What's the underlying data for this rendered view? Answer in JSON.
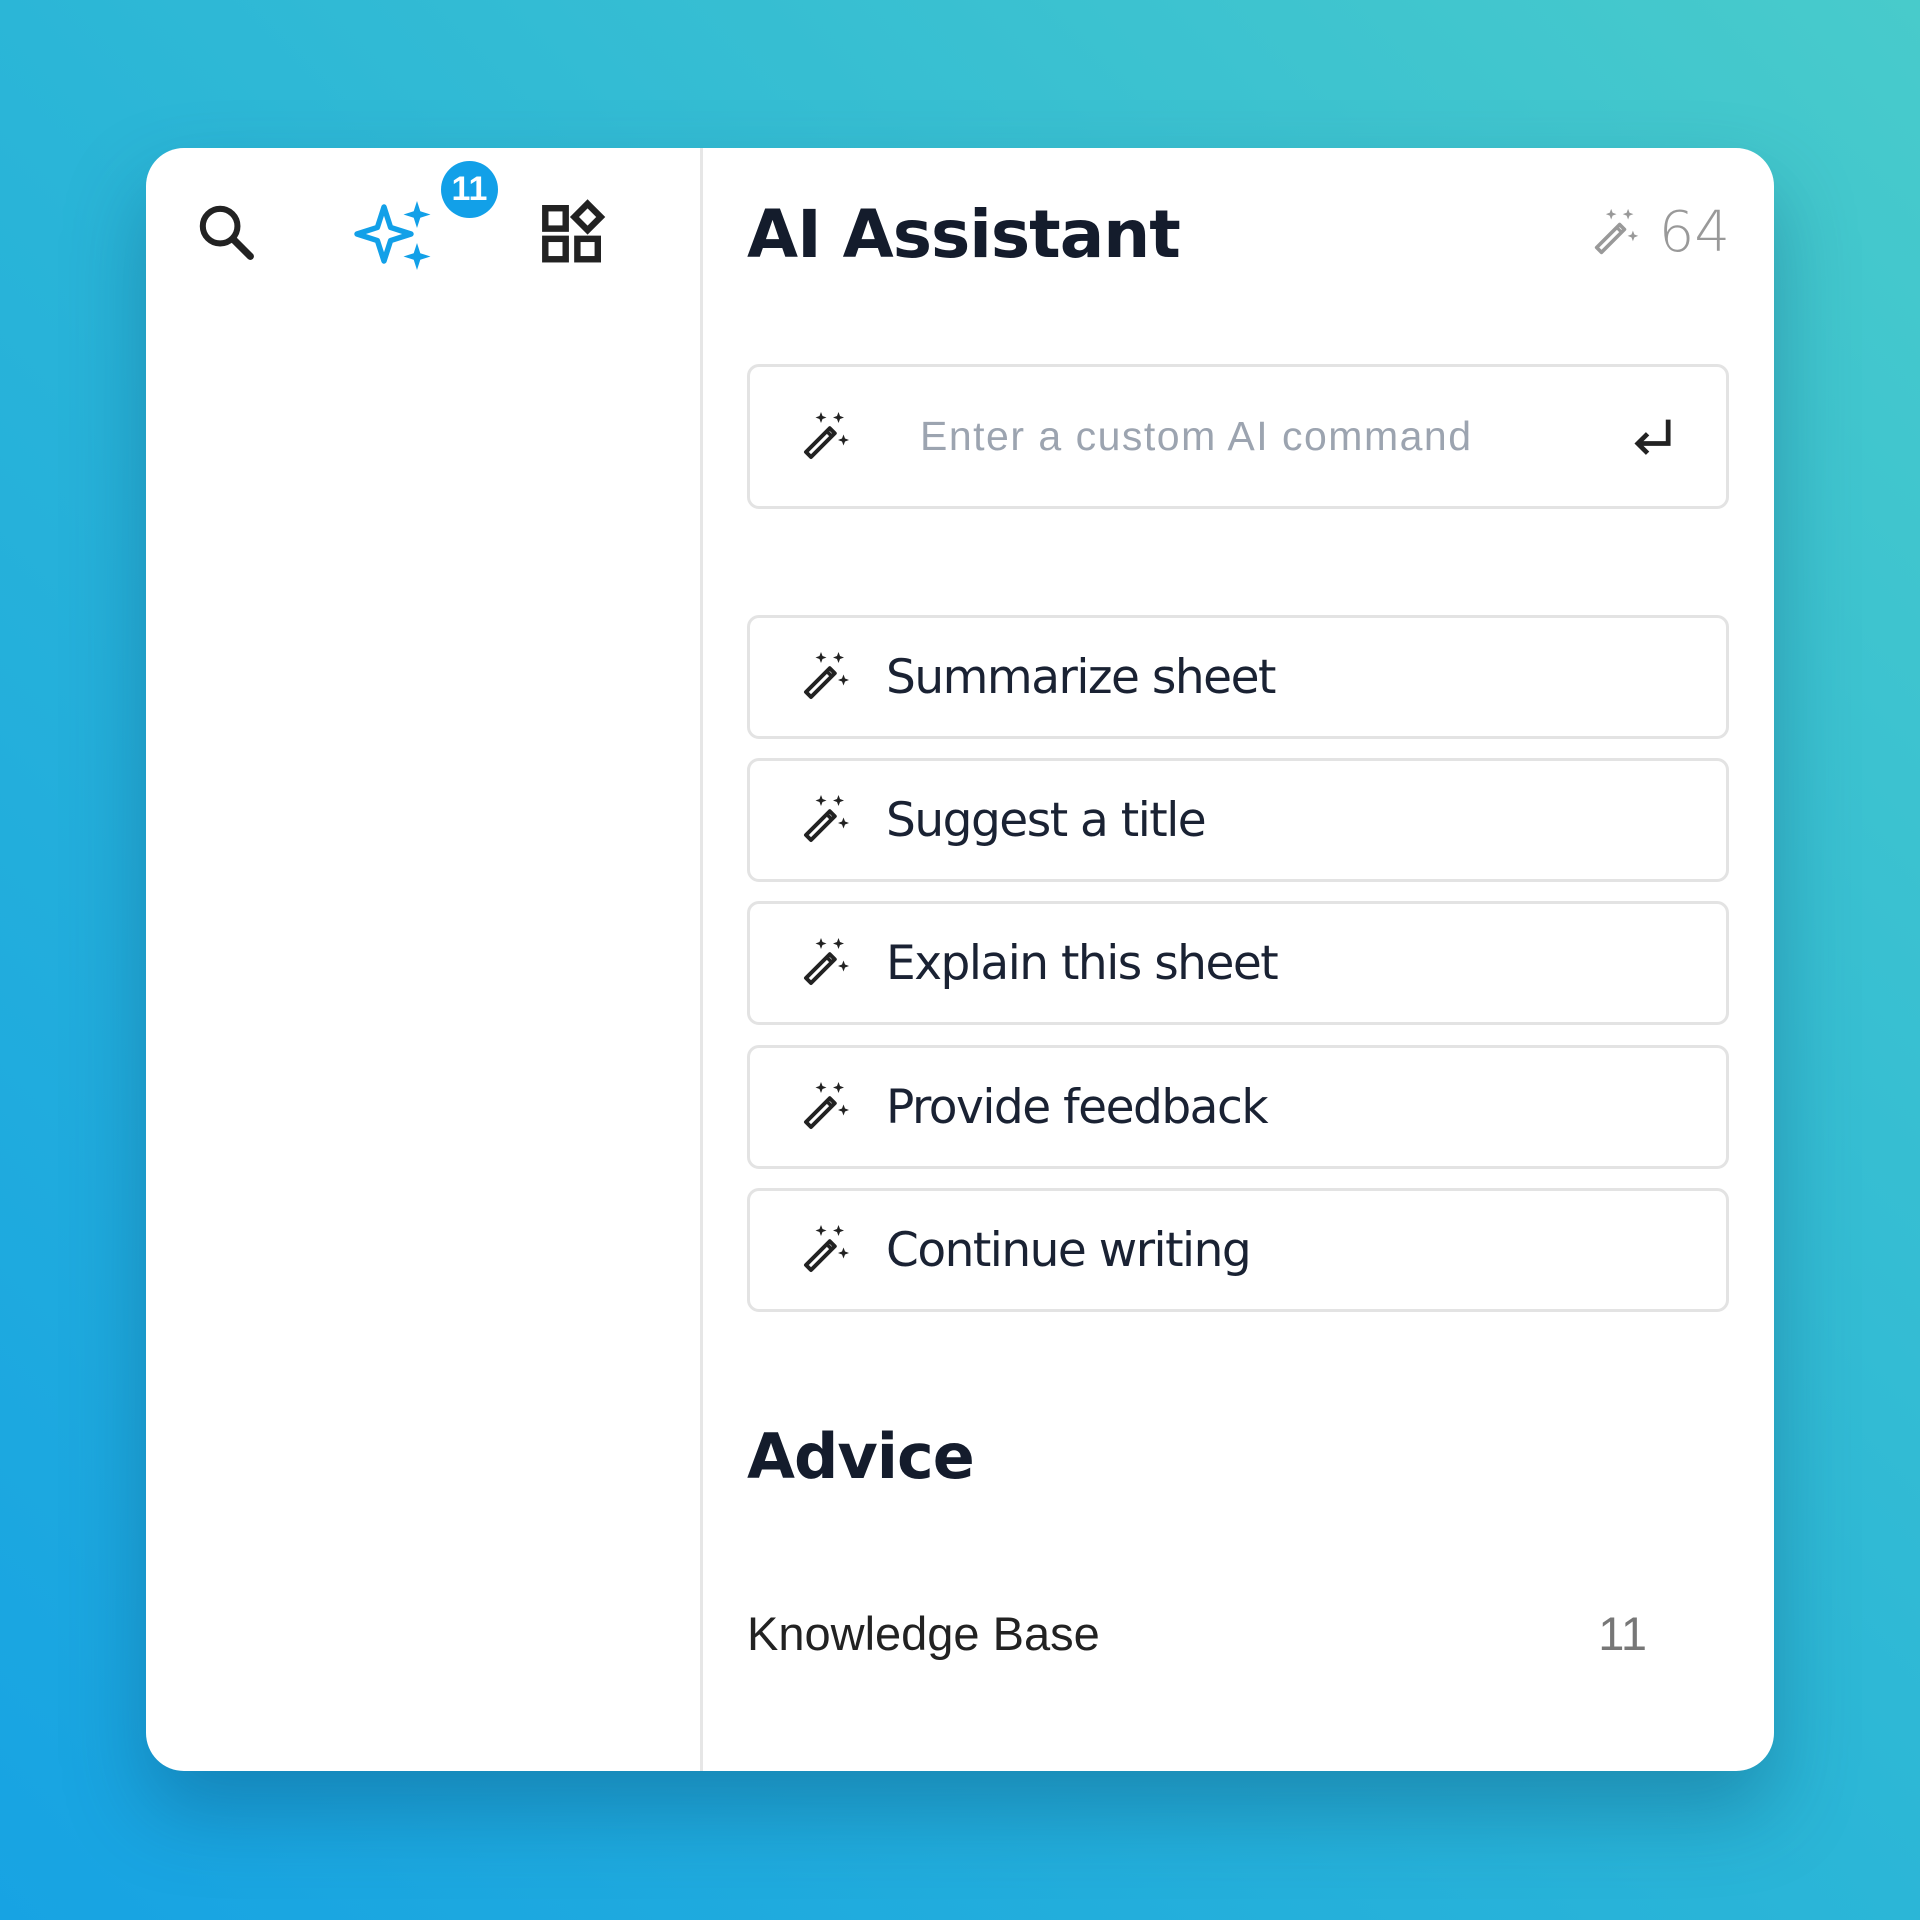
{
  "sidebar": {
    "icons": [
      {
        "name": "search-icon"
      },
      {
        "name": "sparkles-icon",
        "color": "#12a0e8"
      },
      {
        "name": "apps-grid-icon"
      }
    ],
    "ai_badge_count": "11"
  },
  "header": {
    "title": "AI Assistant",
    "credits_icon": "magic-wand-icon",
    "credits_value": "64"
  },
  "command_input": {
    "placeholder": "Enter a custom AI command",
    "value": "",
    "submit_icon": "enter-return-icon"
  },
  "actions": [
    {
      "label": "Summarize sheet",
      "icon": "magic-wand-icon"
    },
    {
      "label": "Suggest a title",
      "icon": "magic-wand-icon"
    },
    {
      "label": "Explain this sheet",
      "icon": "magic-wand-icon"
    },
    {
      "label": "Provide feedback",
      "icon": "magic-wand-icon"
    },
    {
      "label": "Continue writing",
      "icon": "magic-wand-icon"
    }
  ],
  "advice": {
    "title": "Advice",
    "items": [
      {
        "label": "Knowledge Base",
        "count": "11"
      }
    ]
  },
  "colors": {
    "accent": "#12a0e8",
    "text_dark": "#141c2c",
    "muted": "#999999",
    "border": "#e3e3e3"
  }
}
